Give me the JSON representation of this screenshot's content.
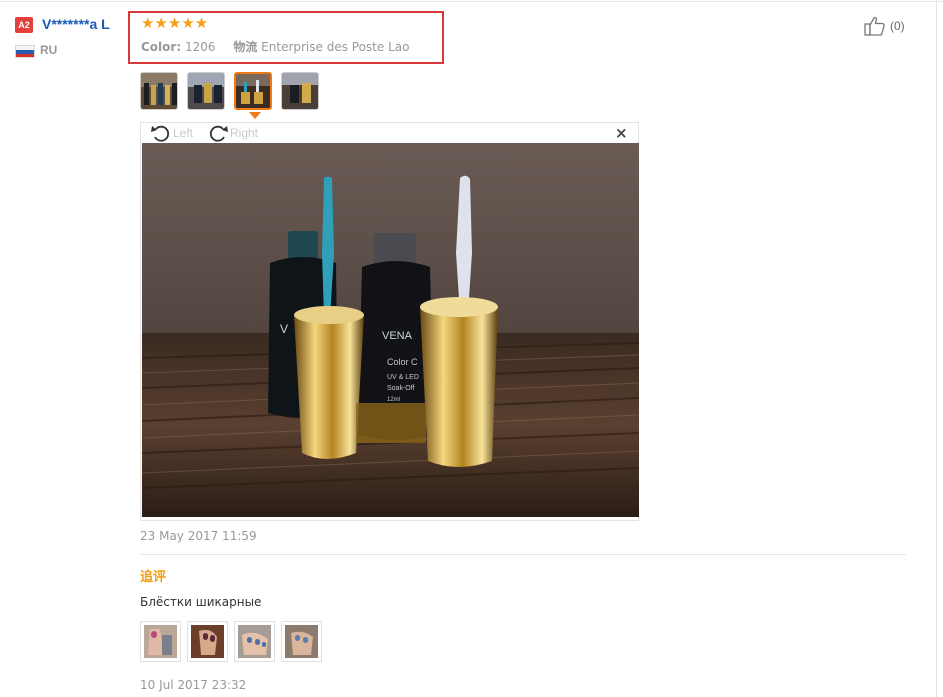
{
  "reviewer": {
    "level_badge": "A2",
    "name": "V*******a L",
    "country": "RU"
  },
  "review": {
    "rating_stars": 5,
    "stars_text": "★★★★★",
    "color_label": "Color:",
    "color_value": "1206",
    "shipping_label": "物流",
    "shipping_value": "Enterprise des Poste Lao",
    "like_count": "(0)",
    "date": "23 May 2017 11:59"
  },
  "viewer": {
    "rotate_left_label": "Left",
    "rotate_right_label": "Right",
    "close_label": "×",
    "photo_brand_text": "VENA",
    "photo_label_lines": [
      "Color C",
      "UV & LED",
      "Soak-Off",
      "12ml"
    ],
    "active_thumbnail_index": 2
  },
  "followup": {
    "title": "追评",
    "text": "Блёстки шикарные",
    "date": "10 Jul 2017 23:32"
  },
  "colors": {
    "star": "#f6a01a",
    "username": "#1a5ab8",
    "badge": "#e3403b",
    "highlight_box": "#d9383a",
    "followup_title": "#f29d12",
    "active_thumb_border": "#ef7b18"
  },
  "icons": [
    "thumbs-up-icon",
    "rotate-left-icon",
    "rotate-right-icon",
    "close-icon",
    "russia-flag-icon"
  ]
}
